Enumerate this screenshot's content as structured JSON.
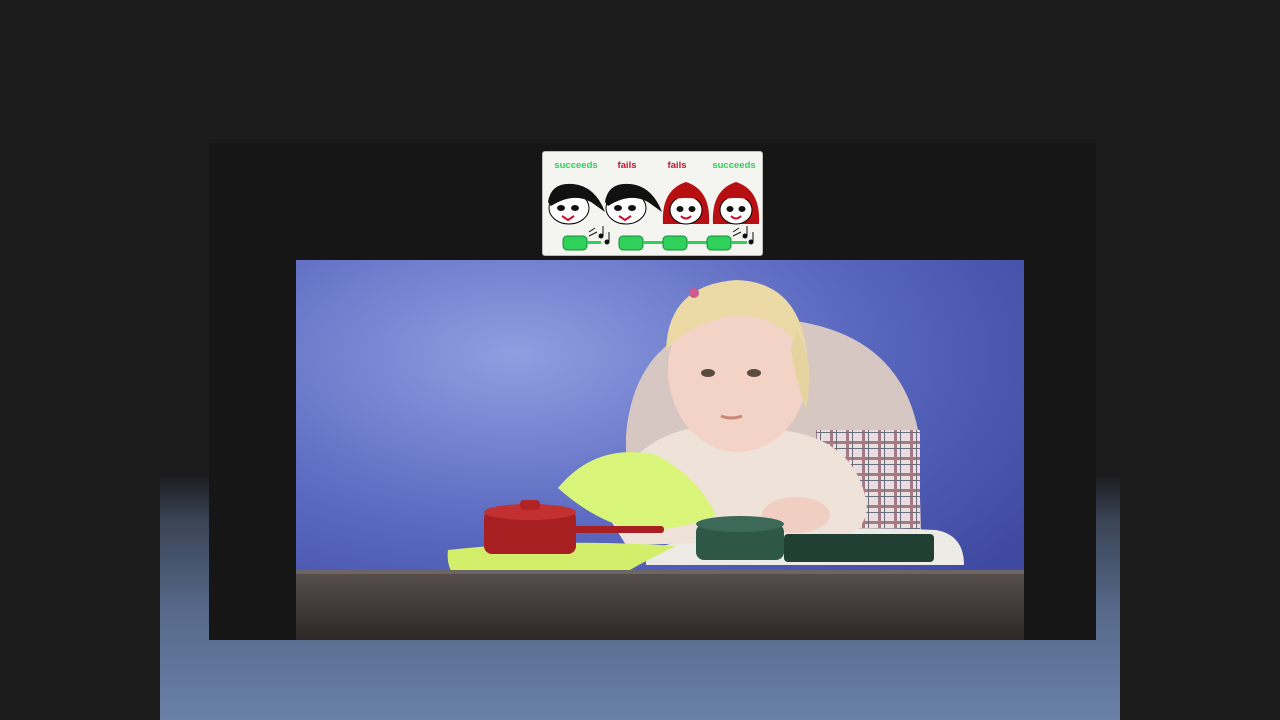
{
  "legend": {
    "outcomes": [
      {
        "label": "succeeds",
        "color": "#2fd15a"
      },
      {
        "label": "fails",
        "color": "#c8102e"
      },
      {
        "label": "fails",
        "color": "#c8102e"
      },
      {
        "label": "succeeds",
        "color": "#2fd15a"
      }
    ],
    "faces": [
      {
        "hair": "black-hair"
      },
      {
        "hair": "black-hair"
      },
      {
        "hair": "red-hair"
      },
      {
        "hair": "red-hair"
      }
    ],
    "toy_color": "#2fd15a"
  },
  "video": {
    "subject": "toddler in high chair with toy pots",
    "background_color": "#5a68c0"
  }
}
